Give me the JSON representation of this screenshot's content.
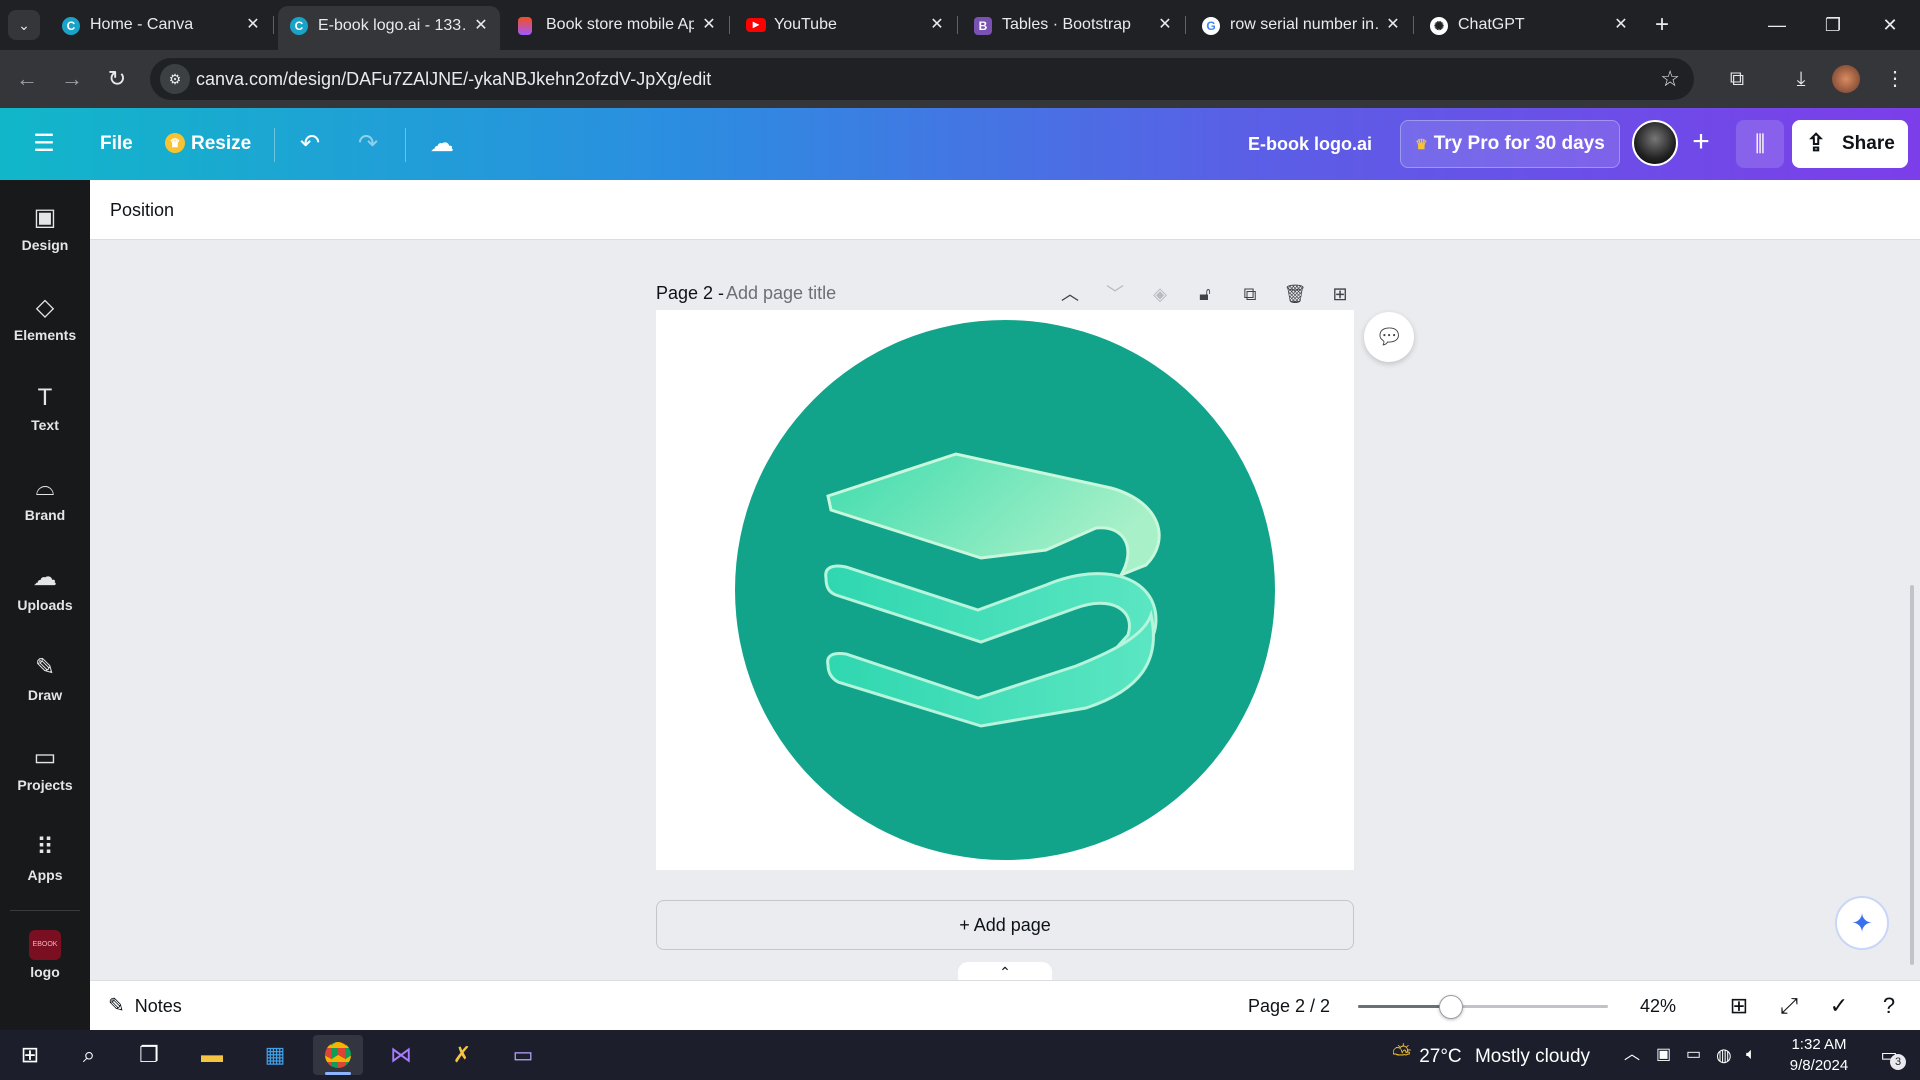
{
  "browser": {
    "tabs": [
      {
        "title": "Home - Canva",
        "favicon": "canva-icon",
        "active": false
      },
      {
        "title": "E-book logo.ai - 133…",
        "favicon": "canva-icon",
        "active": true
      },
      {
        "title": "Book store mobile Ap…",
        "favicon": "figma-icon",
        "active": false
      },
      {
        "title": "YouTube",
        "favicon": "youtube-icon",
        "active": false
      },
      {
        "title": "Tables · Bootstrap",
        "favicon": "bootstrap-icon",
        "active": false
      },
      {
        "title": "row serial number in…",
        "favicon": "google-icon",
        "active": false
      },
      {
        "title": "ChatGPT",
        "favicon": "chatgpt-icon",
        "active": false
      }
    ],
    "url": "canva.com/design/DAFu7ZAlJNE/-ykaNBJkehn2ofzdV-JpXg/edit"
  },
  "canva": {
    "header": {
      "file_label": "File",
      "resize_label": "Resize",
      "doc_title": "E-book logo.ai",
      "pro_label": "Try Pro for 30 days",
      "share_label": "Share"
    },
    "sidebar": [
      {
        "label": "Design",
        "icon": "design-icon"
      },
      {
        "label": "Elements",
        "icon": "elements-icon"
      },
      {
        "label": "Text",
        "icon": "text-icon"
      },
      {
        "label": "Brand",
        "icon": "brand-icon"
      },
      {
        "label": "Uploads",
        "icon": "uploads-icon"
      },
      {
        "label": "Draw",
        "icon": "draw-icon"
      },
      {
        "label": "Projects",
        "icon": "projects-icon"
      },
      {
        "label": "Apps",
        "icon": "apps-icon"
      },
      {
        "label": "logo",
        "icon": "logo-thumbnail"
      }
    ],
    "toolbar": {
      "position_label": "Position"
    },
    "page": {
      "title": "Page 2 -",
      "title_placeholder": "Add page title",
      "logo_colors": {
        "circle": "#12a48a",
        "book_light": "#a8f0c8",
        "book_mid": "#3fdcae"
      }
    },
    "add_page_label": "+ Add page",
    "footer": {
      "notes_label": "Notes",
      "page_indicator": "Page 2 / 2",
      "zoom_label": "42%",
      "zoom_fraction": 0.37
    }
  },
  "taskbar": {
    "weather_temp": "27°C",
    "weather_desc": "Mostly cloudy",
    "time": "1:32 AM",
    "date": "9/8/2024",
    "notification_count": "3"
  }
}
